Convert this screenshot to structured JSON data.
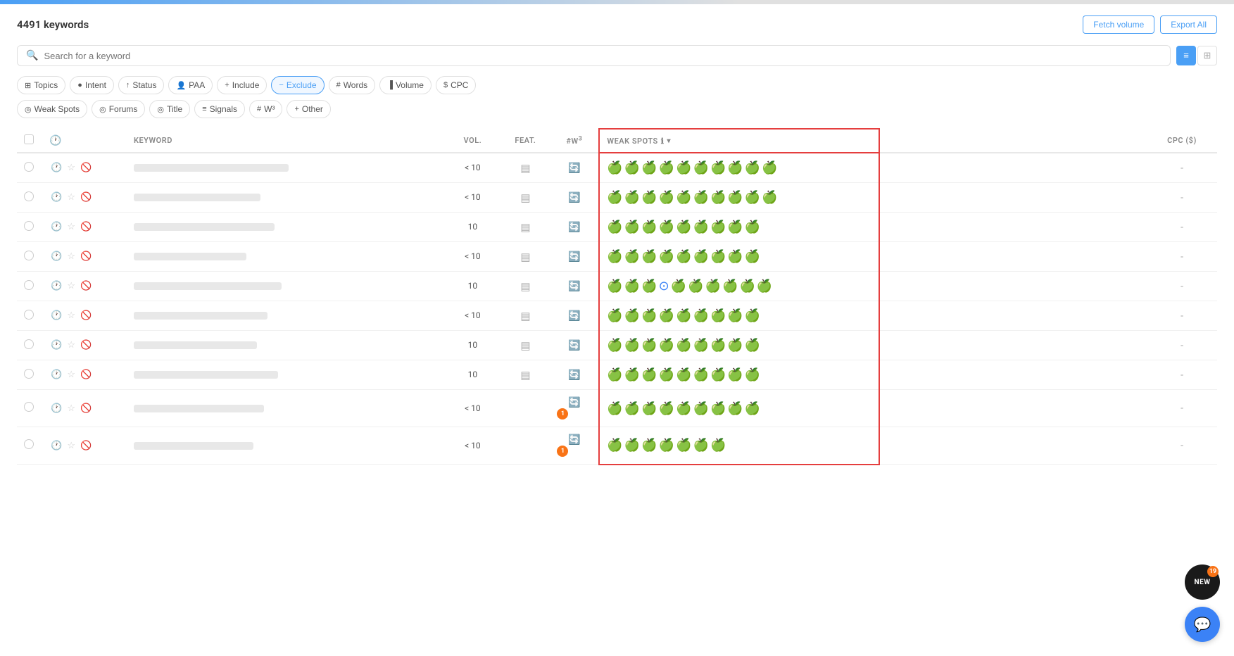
{
  "topbar": {
    "keyword_count": "4491 keywords"
  },
  "header_actions": {
    "fetch_volume": "Fetch volume",
    "export_all": "Export All"
  },
  "search": {
    "placeholder": "Search for a keyword"
  },
  "filters_row1": [
    {
      "id": "topics",
      "label": "Topics",
      "icon": "⊞",
      "active": false
    },
    {
      "id": "intent",
      "label": "Intent",
      "icon": "●",
      "active": false
    },
    {
      "id": "status",
      "label": "Status",
      "icon": "↑",
      "active": false
    },
    {
      "id": "paa",
      "label": "PAA",
      "icon": "👤",
      "active": false
    },
    {
      "id": "include",
      "label": "Include",
      "icon": "+",
      "active": false
    },
    {
      "id": "exclude",
      "label": "Exclude",
      "icon": "−",
      "active": true
    },
    {
      "id": "words",
      "label": "Words",
      "icon": "#",
      "active": false
    },
    {
      "id": "volume",
      "label": "Volume",
      "icon": "▐",
      "active": false
    },
    {
      "id": "cpc",
      "label": "CPC",
      "icon": "$",
      "active": false
    }
  ],
  "filters_row2": [
    {
      "id": "weak_spots",
      "label": "Weak Spots",
      "icon": "◎"
    },
    {
      "id": "forums",
      "label": "Forums",
      "icon": "◎"
    },
    {
      "id": "title",
      "label": "Title",
      "icon": "◎"
    },
    {
      "id": "signals",
      "label": "Signals",
      "icon": "≡"
    },
    {
      "id": "w3",
      "label": "W³",
      "icon": "#"
    },
    {
      "id": "other",
      "label": "Other",
      "icon": "+"
    }
  ],
  "table": {
    "columns": {
      "keyword": "Keyword",
      "vol": "VOL.",
      "feat": "FEAT.",
      "w3": "#W³",
      "weak_spots": "WEAK SPOTS",
      "cpc": "CPC ($)"
    },
    "rows": [
      {
        "vol": "< 10",
        "has_feat": true,
        "has_refresh": true,
        "weak_count": 10,
        "ws_icons": "🍏🍏🍏🍏🍏🍏🍏🍏🍏🍏",
        "cpc": "-",
        "badge": null,
        "keyword_width": 220
      },
      {
        "vol": "< 10",
        "has_feat": true,
        "has_refresh": true,
        "weak_count": 10,
        "ws_icons": "🍏🍏🍏🍏🍏🍏🍏🍏🍏🍏",
        "cpc": "-",
        "badge": null,
        "keyword_width": 180
      },
      {
        "vol": "10",
        "has_feat": true,
        "has_refresh": true,
        "weak_count": 9,
        "ws_icons": "🍏🍏🍏🍏🍏🍏🍏🍏🍏",
        "cpc": "-",
        "badge": null,
        "keyword_width": 200
      },
      {
        "vol": "< 10",
        "has_feat": true,
        "has_refresh": true,
        "weak_count": 9,
        "ws_icons": "🍏🍏🍏🍏🍏🍏🍏🍏🍏",
        "cpc": "-",
        "badge": null,
        "keyword_width": 160
      },
      {
        "vol": "10",
        "has_feat": true,
        "has_refresh": true,
        "weak_count": 10,
        "ws_icons": "🍏🍏🍏⊙🍏🍏🍏🍏🍏🍏",
        "cpc": "-",
        "badge": null,
        "keyword_width": 210,
        "has_blue": true,
        "blue_idx": 3
      },
      {
        "vol": "< 10",
        "has_feat": true,
        "has_refresh": true,
        "weak_count": 9,
        "ws_icons": "🍏🍏🍏🍏🍏🍏🍏🍏🍏",
        "cpc": "-",
        "badge": null,
        "keyword_width": 190
      },
      {
        "vol": "10",
        "has_feat": true,
        "has_refresh": true,
        "weak_count": 9,
        "ws_icons": "🍏🍏🍏🍏🍏🍏🍏🍏🍏",
        "cpc": "-",
        "badge": null,
        "keyword_width": 175
      },
      {
        "vol": "10",
        "has_feat": true,
        "has_refresh": true,
        "weak_count": 9,
        "ws_icons": "🍏🍏🍏🍏🍏🍏🍏🍏🍏",
        "cpc": "-",
        "badge": null,
        "keyword_width": 205
      },
      {
        "vol": "< 10",
        "has_feat": false,
        "has_refresh": true,
        "weak_count": 9,
        "ws_icons": "🍏🍏🍏🍏🍏🍏🍏🍏🍏",
        "cpc": "-",
        "badge": "1",
        "keyword_width": 185
      },
      {
        "vol": "< 10",
        "has_feat": false,
        "has_refresh": true,
        "weak_count": 7,
        "ws_icons": "🍏🍏🍏🍏🍏🍏🍏",
        "cpc": "-",
        "badge": "1",
        "keyword_width": 170
      }
    ]
  },
  "fab": {
    "new_label": "NEW",
    "new_count": "19",
    "chat_icon": "💬"
  }
}
